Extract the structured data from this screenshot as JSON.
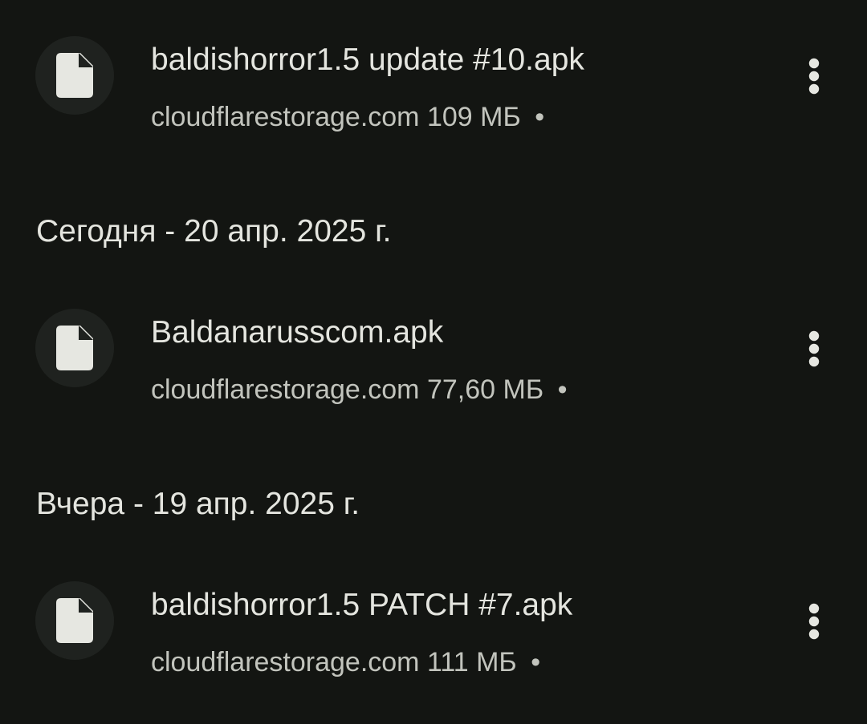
{
  "downloads": {
    "top_item": {
      "icon": "file-icon",
      "name": "baldishorror1.5 update #10.apk",
      "source": "cloudflarestorage.com",
      "size": "109 МБ",
      "separator": "•",
      "menu_icon": "more-vert-icon"
    },
    "groups": [
      {
        "header": "Сегодня - 20 апр. 2025 г.",
        "items": [
          {
            "icon": "file-icon",
            "name": "Baldanarusscom.apk",
            "source": "cloudflarestorage.com",
            "size": "77,60 МБ",
            "separator": "•",
            "menu_icon": "more-vert-icon"
          }
        ]
      },
      {
        "header": "Вчера - 19 апр. 2025 г.",
        "items": [
          {
            "icon": "file-icon",
            "name": "baldishorror1.5 PATCH #7.apk",
            "source": "cloudflarestorage.com",
            "size": "111 МБ",
            "separator": "•",
            "menu_icon": "more-vert-icon"
          }
        ]
      }
    ]
  },
  "colors": {
    "background": "#131512",
    "icon_circle": "#1f221f",
    "primary_text": "#e4e5df",
    "secondary_text": "#c2c4bd"
  }
}
